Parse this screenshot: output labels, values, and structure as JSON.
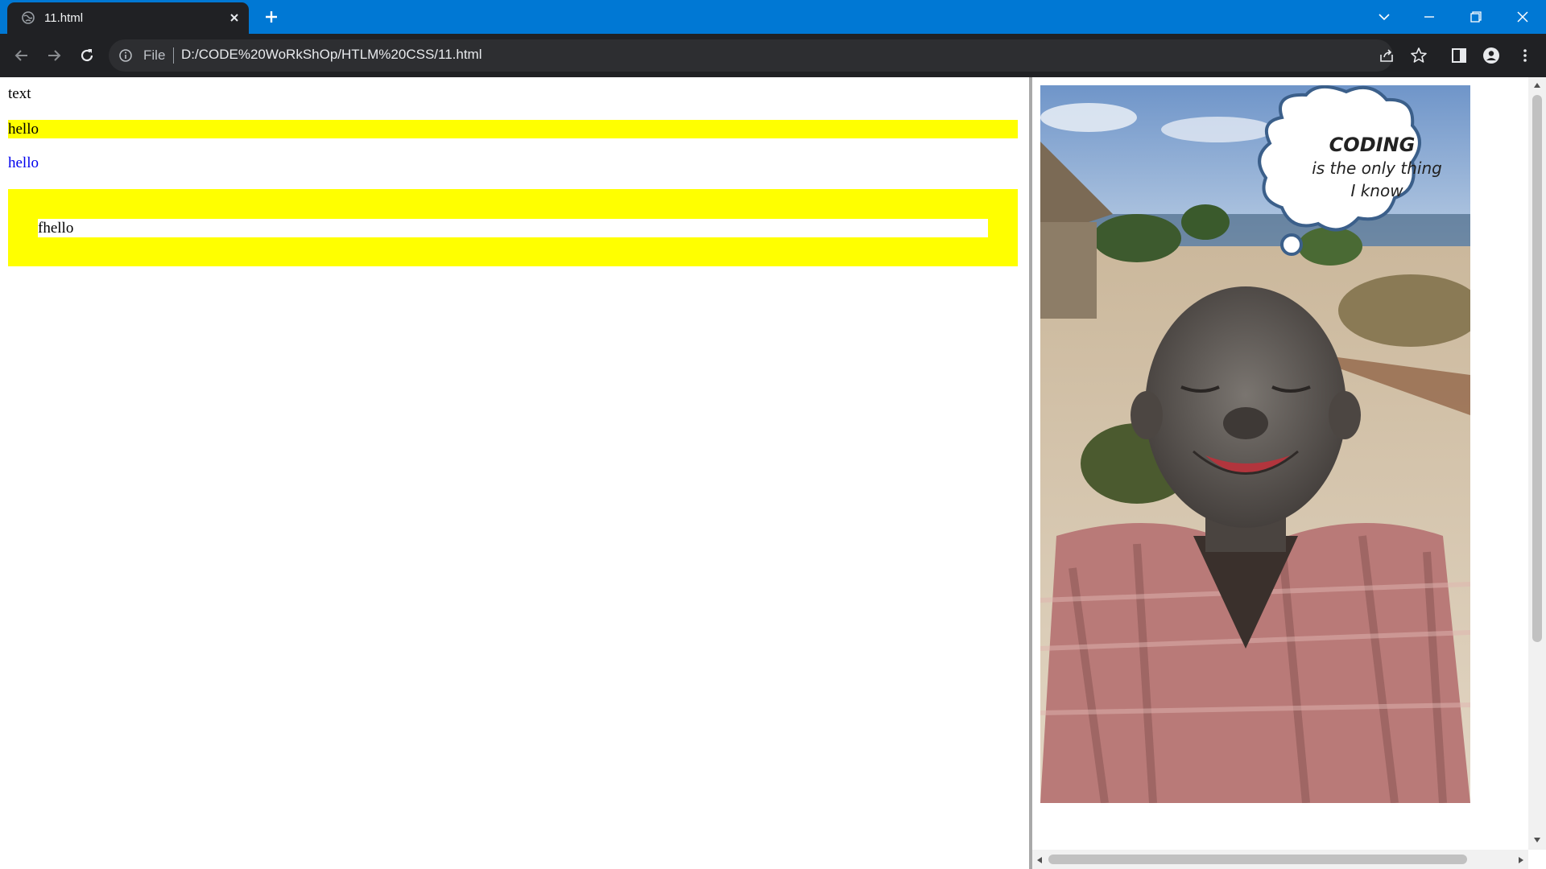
{
  "tab": {
    "title": "11.html"
  },
  "address_bar": {
    "scheme_label": "File",
    "url": "D:/CODE%20WoRkShOp/HTLM%20CSS/11.html"
  },
  "page": {
    "text_line": "text",
    "hello_yellow": "hello",
    "hello_blue": "hello",
    "inner_box_text": "fhello"
  },
  "image": {
    "bubble_line1": "CODING",
    "bubble_line2": "is the only thing",
    "bubble_line3": "I know"
  },
  "colors": {
    "titlebar": "#0078d4",
    "toolbar": "#202124",
    "highlight_yellow": "#ffff00",
    "link_blue": "#0000ee"
  },
  "icons": [
    "globe-icon",
    "close-icon",
    "plus-icon",
    "chevron-down-icon",
    "minimize-icon",
    "restore-icon",
    "window-close-icon",
    "back-arrow-icon",
    "forward-arrow-icon",
    "reload-icon",
    "info-icon",
    "share-icon",
    "star-icon",
    "side-panel-icon",
    "profile-icon",
    "kebab-menu-icon"
  ]
}
